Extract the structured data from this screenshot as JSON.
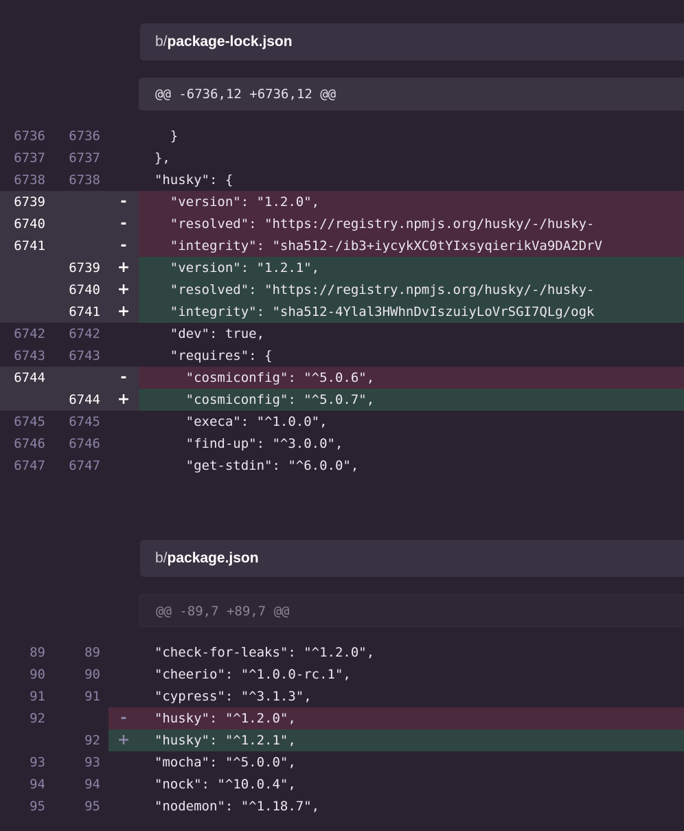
{
  "files": [
    {
      "dir": "b/",
      "name": "package-lock.json",
      "hunk": "@@ -6736,12 +6736,12 @@",
      "lines": [
        {
          "type": "ctx",
          "old": "6736",
          "new": "6736",
          "marker": "",
          "code": "    }"
        },
        {
          "type": "ctx",
          "old": "6737",
          "new": "6737",
          "marker": "",
          "code": "  },"
        },
        {
          "type": "ctx",
          "old": "6738",
          "new": "6738",
          "marker": "",
          "code": "  \"husky\": {"
        },
        {
          "type": "del",
          "old": "6739",
          "new": "",
          "marker": "-",
          "code": "    \"version\": \"1.2.0\","
        },
        {
          "type": "del",
          "old": "6740",
          "new": "",
          "marker": "-",
          "code": "    \"resolved\": \"https://registry.npmjs.org/husky/-/husky-"
        },
        {
          "type": "del",
          "old": "6741",
          "new": "",
          "marker": "-",
          "code": "    \"integrity\": \"sha512-/ib3+iycykXC0tYIxsyqierikVa9DA2DrV"
        },
        {
          "type": "add",
          "old": "",
          "new": "6739",
          "marker": "+",
          "code": "    \"version\": \"1.2.1\","
        },
        {
          "type": "add",
          "old": "",
          "new": "6740",
          "marker": "+",
          "code": "    \"resolved\": \"https://registry.npmjs.org/husky/-/husky-"
        },
        {
          "type": "add",
          "old": "",
          "new": "6741",
          "marker": "+",
          "code": "    \"integrity\": \"sha512-4Ylal3HWhnDvIszuiyLoVrSGI7QLg/ogk"
        },
        {
          "type": "ctx",
          "old": "6742",
          "new": "6742",
          "marker": "",
          "code": "    \"dev\": true,"
        },
        {
          "type": "ctx",
          "old": "6743",
          "new": "6743",
          "marker": "",
          "code": "    \"requires\": {"
        },
        {
          "type": "del",
          "old": "6744",
          "new": "",
          "marker": "-",
          "code": "      \"cosmiconfig\": \"^5.0.6\","
        },
        {
          "type": "add",
          "old": "",
          "new": "6744",
          "marker": "+",
          "code": "      \"cosmiconfig\": \"^5.0.7\","
        },
        {
          "type": "ctx",
          "old": "6745",
          "new": "6745",
          "marker": "",
          "code": "      \"execa\": \"^1.0.0\","
        },
        {
          "type": "ctx",
          "old": "6746",
          "new": "6746",
          "marker": "",
          "code": "      \"find-up\": \"^3.0.0\","
        },
        {
          "type": "ctx",
          "old": "6747",
          "new": "6747",
          "marker": "",
          "code": "      \"get-stdin\": \"^6.0.0\","
        }
      ]
    },
    {
      "dir": "b/",
      "name": "package.json",
      "hunk": "@@ -89,7 +89,7 @@",
      "lines": [
        {
          "type": "ctx",
          "old": "89",
          "new": "89",
          "marker": "",
          "code": "  \"check-for-leaks\": \"^1.2.0\","
        },
        {
          "type": "ctx",
          "old": "90",
          "new": "90",
          "marker": "",
          "code": "  \"cheerio\": \"^1.0.0-rc.1\","
        },
        {
          "type": "ctx",
          "old": "91",
          "new": "91",
          "marker": "",
          "code": "  \"cypress\": \"^3.1.3\","
        },
        {
          "type": "del",
          "old": "92",
          "new": "",
          "marker": "-",
          "code": "  \"husky\": \"^1.2.0\","
        },
        {
          "type": "add",
          "old": "",
          "new": "92",
          "marker": "+",
          "code": "  \"husky\": \"^1.2.1\","
        },
        {
          "type": "ctx",
          "old": "93",
          "new": "93",
          "marker": "",
          "code": "  \"mocha\": \"^5.0.0\","
        },
        {
          "type": "ctx",
          "old": "94",
          "new": "94",
          "marker": "",
          "code": "  \"nock\": \"^10.0.4\","
        },
        {
          "type": "ctx",
          "old": "95",
          "new": "95",
          "marker": "",
          "code": "  \"nodemon\": \"^1.18.7\","
        }
      ]
    }
  ],
  "colors": {
    "background": "#2b2231",
    "deleted_line": "#4b2a3d",
    "added_line": "#2f4541",
    "line_number": "#8a84a6"
  }
}
